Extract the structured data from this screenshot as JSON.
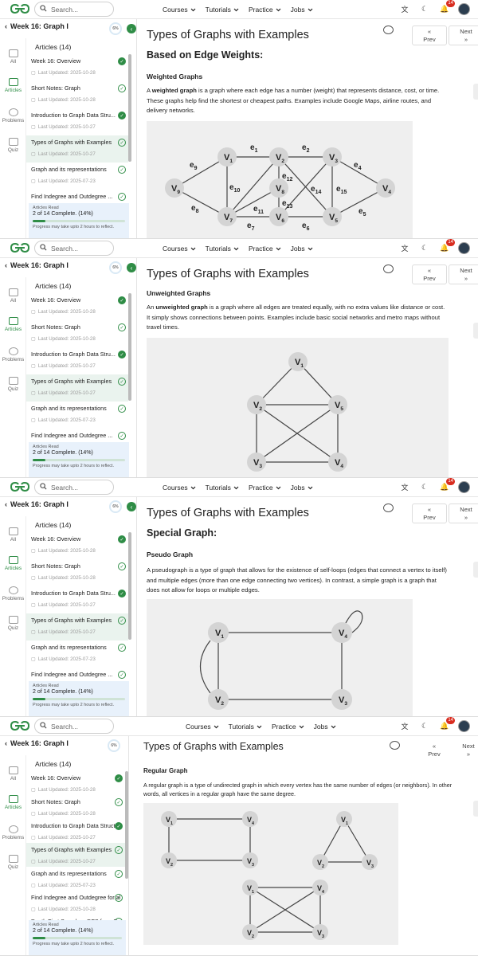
{
  "header": {
    "search_placeholder": "Search...",
    "nav": [
      "Courses",
      "Tutorials",
      "Practice",
      "Jobs"
    ],
    "notif_count": "14"
  },
  "sidebar": {
    "week_title": "Week 16: Graph I",
    "progress_pct": "6%",
    "rail": [
      "All",
      "Articles",
      "Problems",
      "Quiz"
    ],
    "articles_heading": "Articles (14)",
    "articles": [
      {
        "title": "Week 16: Overview",
        "date": "Last Updated: 2025-10-28",
        "done": true
      },
      {
        "title": "Short Notes: Graph",
        "date": "Last Updated: 2025-10-28",
        "done": false
      },
      {
        "title": "Introduction to Graph Data Stru...",
        "date": "Last Updated: 2025-10-27",
        "done": true
      },
      {
        "title": "Types of Graphs with Examples",
        "date": "Last Updated: 2025-10-27",
        "done": false
      },
      {
        "title": "Graph and its representations",
        "date": "Last Updated: 2025-07-23",
        "done": false
      },
      {
        "title": "Find Indegree and Outdegree ...",
        "date": "Last Updated: 2025-10-28",
        "done": false
      }
    ],
    "articles_p4": [
      {
        "title": "Week 16: Overview",
        "date": "Last Updated: 2025-10-28",
        "done": true
      },
      {
        "title": "Short Notes: Graph",
        "date": "Last Updated: 2025-10-28",
        "done": false
      },
      {
        "title": "Introduction to Graph Data Structure",
        "date": "Last Updated: 2025-10-27",
        "done": true
      },
      {
        "title": "Types of Graphs with Examples",
        "date": "Last Updated: 2025-10-27",
        "done": false
      },
      {
        "title": "Graph and its representations",
        "date": "Last Updated: 2025-07-23",
        "done": false
      },
      {
        "title": "Find Indegree and Outdegree for all...",
        "date": "Last Updated: 2025-10-28",
        "done": false
      },
      {
        "title": "Depth First Search or DFS for a Gra...",
        "date": "",
        "done": false
      }
    ],
    "read_label": "Articles Read",
    "read_status": "2 of 14 Complete. (14%)",
    "read_fraction": 0.14,
    "read_note": "Progress may take upto 2 hours to reflect."
  },
  "content": {
    "title": "Types of Graphs with Examples",
    "prev": "Prev",
    "next": "Next",
    "s1": {
      "h2": "Based on Edge Weights:",
      "h3": "Weighted Graphs",
      "p_pre": "A ",
      "p_bold": "weighted graph",
      "p_post": " is a graph where each edge has a number (weight) that represents distance, cost, or time. These graphs help find the shortest or cheapest paths. Examples include Google Maps, airline routes, and delivery networks."
    },
    "s2": {
      "h3": "Unweighted Graphs",
      "p_pre": "An ",
      "p_bold": "unweighted graph",
      "p_post": " is a graph where all edges are treated equally, with no extra values like distance or cost. It simply shows connections between points. Examples include basic social networks and metro maps without travel times."
    },
    "s3": {
      "h2": "Special Graph:",
      "h3": "Pseudo Graph",
      "p": "A pseudograph is a type of graph that allows for the existence of self-loops (edges that connect a vertex to itself) and multiple edges (more than one edge connecting two vertices). In contrast, a simple graph is a graph that does not allow for loops or multiple edges."
    },
    "s4": {
      "h3": "Regular Graph",
      "p": "A regular graph is a type of undirected graph in which every vertex has the same number of edges (or neighbors). In other words, all vertices in a regular graph have the same degree."
    }
  }
}
